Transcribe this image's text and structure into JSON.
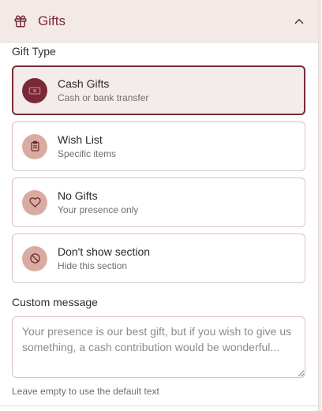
{
  "section": {
    "title": "Gifts",
    "icon": "gift-icon",
    "expanded": true
  },
  "gift_type": {
    "label": "Gift Type",
    "selected": "cash",
    "options": [
      {
        "id": "cash",
        "title": "Cash Gifts",
        "subtitle": "Cash or bank transfer",
        "icon": "banknote-icon"
      },
      {
        "id": "wishlist",
        "title": "Wish List",
        "subtitle": "Specific items",
        "icon": "clipboard-list-icon"
      },
      {
        "id": "none",
        "title": "No Gifts",
        "subtitle": "Your presence only",
        "icon": "heart-icon"
      },
      {
        "id": "hide",
        "title": "Don't show section",
        "subtitle": "Hide this section",
        "icon": "ban-icon"
      }
    ]
  },
  "custom_message": {
    "label": "Custom message",
    "value": "",
    "placeholder": "Your presence is our best gift, but if you wish to give us something, a cash contribution would be wonderful...",
    "hint": "Leave empty to use the default text"
  },
  "colors": {
    "accent": "#7a2a37",
    "icon_bg": "#d9aca2",
    "header_bg": "#f3e9e6",
    "selected_bg": "#f4ecea",
    "border": "#d8c4bf"
  }
}
